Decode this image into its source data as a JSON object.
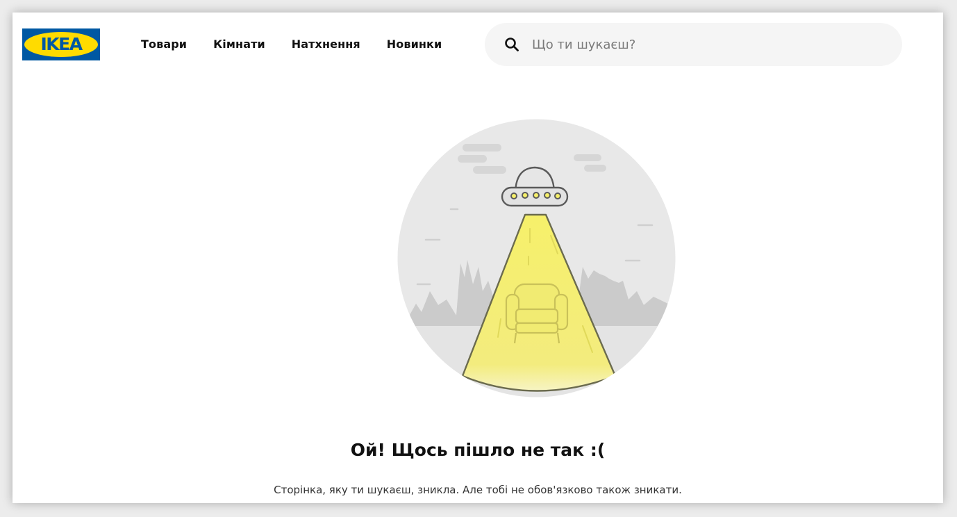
{
  "brand": {
    "logo_text": "IKEA",
    "blue": "#0058A3",
    "yellow": "#FFDB00"
  },
  "nav": {
    "items": [
      {
        "label": "Товари"
      },
      {
        "label": "Кімнати"
      },
      {
        "label": "Натхнення"
      },
      {
        "label": "Новинки"
      }
    ]
  },
  "search": {
    "icon": "search-icon",
    "placeholder": "Що ти шукаєш?",
    "value": ""
  },
  "illustration": {
    "icon": "ufo-abducting-armchair-illustration"
  },
  "error": {
    "title": "Ой! Щось пішло не так :(",
    "message": "Сторінка, яку ти шукаєш, зникла. Але тобі не обов'язково також зникати."
  }
}
